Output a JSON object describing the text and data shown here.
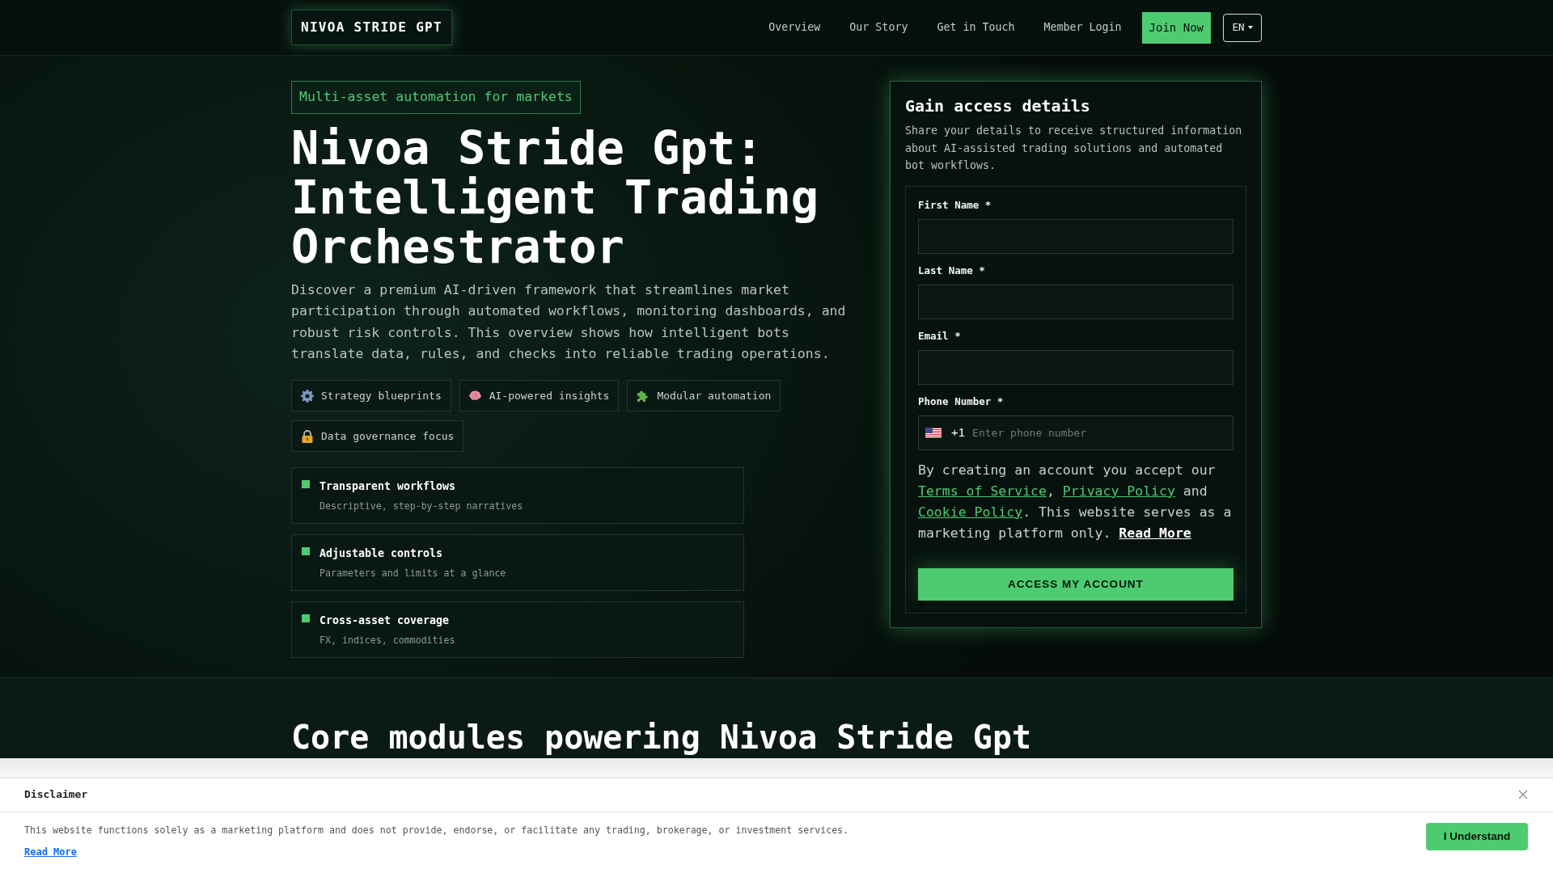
{
  "header": {
    "logo": "NIVOA STRIDE GPT",
    "nav": [
      {
        "label": "Overview"
      },
      {
        "label": "Our Story"
      },
      {
        "label": "Get in Touch"
      },
      {
        "label": "Member Login"
      }
    ],
    "join_button": "Join Now",
    "language": "EN"
  },
  "hero": {
    "tagline": "Multi-asset automation for markets",
    "title": "Nivoa Stride Gpt: Intelligent Trading Orchestrator",
    "description": "Discover a premium AI-driven framework that streamlines market participation through automated workflows, monitoring dashboards, and robust risk controls. This overview shows how intelligent bots translate data, rules, and checks into reliable trading operations.",
    "chips": [
      {
        "label": "Strategy blueprints"
      },
      {
        "label": "AI-powered insights"
      },
      {
        "label": "Modular automation"
      },
      {
        "label": "Data governance focus"
      }
    ],
    "features": [
      {
        "title": "Transparent workflows",
        "subtitle": "Descriptive, step-by-step narratives"
      },
      {
        "title": "Adjustable controls",
        "subtitle": "Parameters and limits at a glance"
      },
      {
        "title": "Cross-asset coverage",
        "subtitle": "FX, indices, commodities"
      }
    ]
  },
  "signup_form": {
    "title": "Gain access details",
    "subtitle": "Share your details to receive structured information about AI-assisted trading solutions and automated bot workflows.",
    "fields": [
      {
        "kind": "text",
        "label": "First Name *"
      },
      {
        "kind": "text",
        "label": "Last Name *"
      },
      {
        "kind": "text",
        "label": "Email *"
      },
      {
        "kind": "phone",
        "label": "Phone Number *",
        "dial_code": "+1",
        "placeholder": "Enter phone number"
      }
    ],
    "consent": [
      {
        "kind": "text",
        "text": "By creating an account you accept our "
      },
      {
        "kind": "link",
        "text": "Terms of Service"
      },
      {
        "kind": "text",
        "text": ", "
      },
      {
        "kind": "link",
        "text": "Privacy Policy"
      },
      {
        "kind": "text",
        "text": " and "
      },
      {
        "kind": "link",
        "text": "Cookie Policy"
      },
      {
        "kind": "text",
        "text": ". This website serves as a marketing platform only. "
      },
      {
        "kind": "bold_link",
        "text": "Read More"
      }
    ],
    "submit": "ACCESS MY ACCOUNT"
  },
  "next_section": {
    "heading": "Core modules powering Nivoa Stride Gpt"
  },
  "disclaimer": {
    "title": "Disclaimer",
    "text": "This website functions solely as a marketing platform and does not provide, endorse, or facilitate any trading, brokerage, or investment services.",
    "link": "Read More",
    "button": "I Understand"
  }
}
